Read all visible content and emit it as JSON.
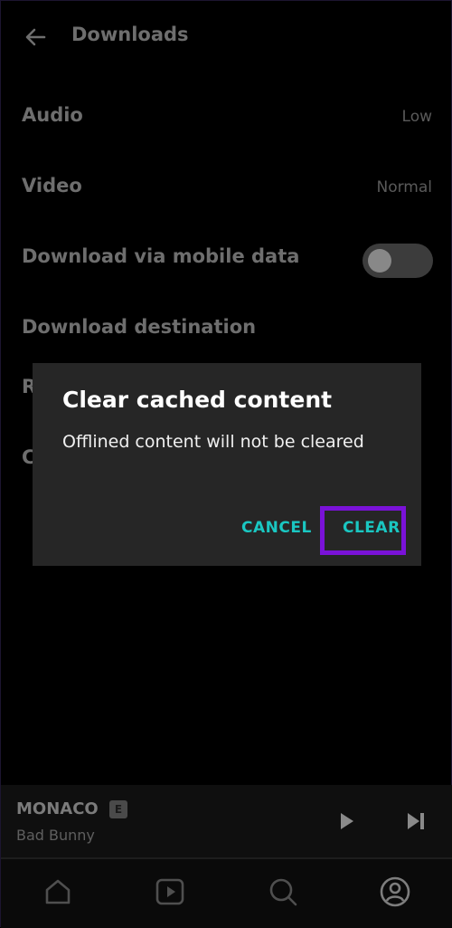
{
  "header": {
    "title": "Downloads"
  },
  "settings": {
    "audio": {
      "label": "Audio",
      "value": "Low"
    },
    "video": {
      "label": "Video",
      "value": "Normal"
    },
    "mobile_data": {
      "label": "Download via mobile data",
      "enabled": false
    },
    "destination": {
      "label": "Download destination"
    },
    "row5_partial": "R",
    "row6_partial": "C"
  },
  "dialog": {
    "title": "Clear cached content",
    "message": "Offlined content will not be cleared",
    "cancel_label": "CANCEL",
    "clear_label": "CLEAR",
    "accent_color": "#1ac7c2",
    "highlight_color": "#7a12d8"
  },
  "player": {
    "track": "MONACO",
    "explicit_badge": "E",
    "artist": "Bad Bunny",
    "icons": [
      "play-icon",
      "skip-next-icon"
    ]
  },
  "nav": {
    "items": [
      "home-icon",
      "videos-icon",
      "search-icon",
      "profile-icon"
    ]
  }
}
